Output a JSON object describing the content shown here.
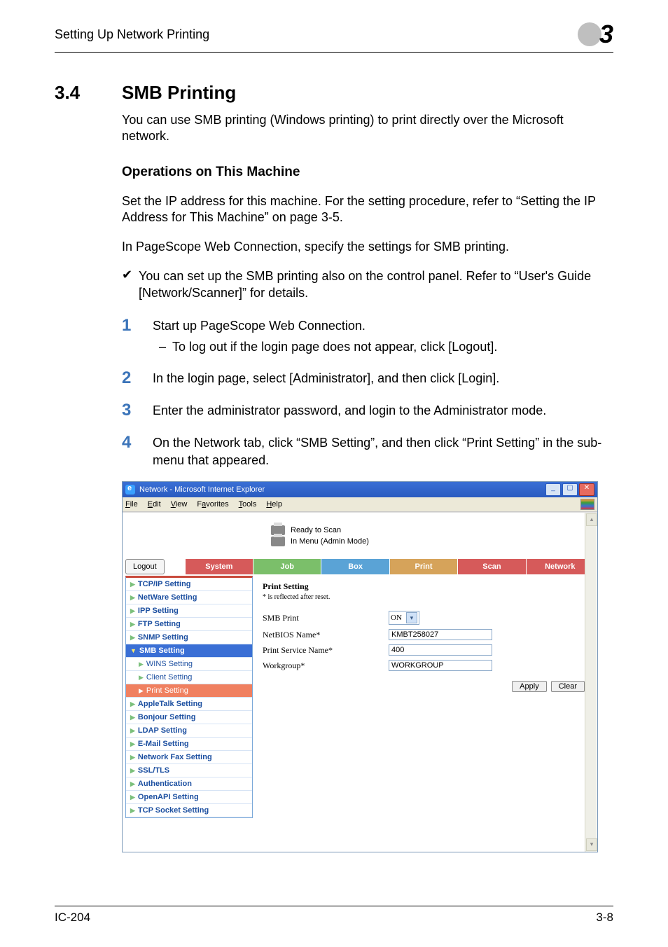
{
  "header": {
    "text": "Setting Up Network Printing",
    "chapter": "3"
  },
  "section": {
    "num": "3.4",
    "title": "SMB Printing"
  },
  "intro": "You can use SMB printing (Windows printing) to print directly over the Microsoft network.",
  "sub_heading": "Operations on This Machine",
  "para1": "Set the IP address for this machine. For the setting procedure, refer to “Setting the IP Address for This Machine” on page 3-5.",
  "para2": "In PageScope Web Connection, specify the settings for SMB printing.",
  "check1": "You can set up the SMB printing also on the control panel. Refer to “User's Guide [Network/Scanner]” for details.",
  "steps": [
    {
      "n": "1",
      "text": "Start up PageScope Web Connection.",
      "sub": "To log out if the login page does not appear, click [Logout]."
    },
    {
      "n": "2",
      "text": "In the login page, select [Administrator], and then click [Login]."
    },
    {
      "n": "3",
      "text": "Enter the administrator password, and login to the Administrator mode."
    },
    {
      "n": "4",
      "text": "On the Network tab, click “SMB Setting”, and then click “Print Setting” in the sub-menu that appeared."
    }
  ],
  "shot": {
    "title": "Network - Microsoft Internet Explorer",
    "menus": [
      "File",
      "Edit",
      "View",
      "Favorites",
      "Tools",
      "Help"
    ],
    "status1": "Ready to Scan",
    "status2": "In Menu (Admin Mode)",
    "logout": "Logout",
    "tabs": [
      "System",
      "Job",
      "Box",
      "Print",
      "Scan",
      "Network"
    ],
    "sidebar": [
      {
        "label": "TCP/IP Setting"
      },
      {
        "label": "NetWare Setting"
      },
      {
        "label": "IPP Setting"
      },
      {
        "label": "FTP Setting"
      },
      {
        "label": "SNMP Setting"
      },
      {
        "label": "SMB Setting",
        "expanded": true,
        "children": [
          {
            "label": "WINS Setting"
          },
          {
            "label": "Client Setting"
          },
          {
            "label": "Print Setting",
            "selected": true
          }
        ]
      },
      {
        "label": "AppleTalk Setting"
      },
      {
        "label": "Bonjour Setting"
      },
      {
        "label": "LDAP Setting"
      },
      {
        "label": "E-Mail Setting"
      },
      {
        "label": "Network Fax Setting"
      },
      {
        "label": "SSL/TLS"
      },
      {
        "label": "Authentication"
      },
      {
        "label": "OpenAPI Setting"
      },
      {
        "label": "TCP Socket Setting"
      }
    ],
    "pane": {
      "title": "Print Setting",
      "note": "* is reflected after reset.",
      "fields": [
        {
          "label": "SMB Print",
          "type": "select",
          "value": "ON"
        },
        {
          "label": "NetBIOS Name*",
          "type": "text",
          "value": "KMBT258027"
        },
        {
          "label": "Print Service Name*",
          "type": "text",
          "value": "400"
        },
        {
          "label": "Workgroup*",
          "type": "text",
          "value": "WORKGROUP"
        }
      ],
      "buttons": {
        "apply": "Apply",
        "clear": "Clear"
      }
    }
  },
  "footer": {
    "left": "IC-204",
    "right": "3-8"
  }
}
